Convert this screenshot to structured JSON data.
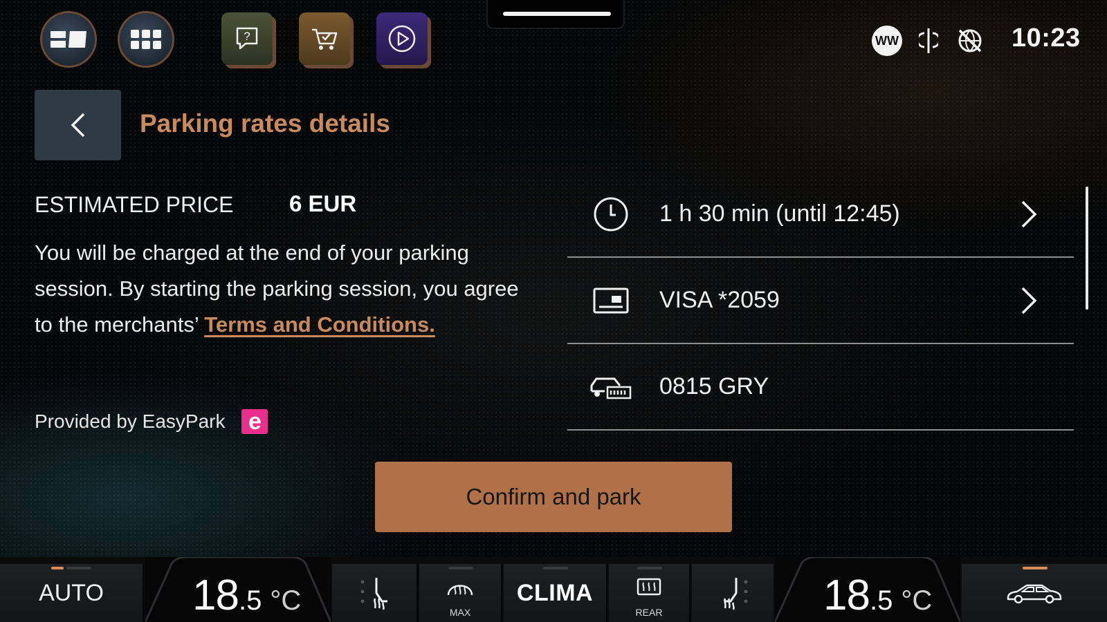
{
  "top_bar": {
    "clock": "10:23",
    "status_badge": "WW"
  },
  "header": {
    "title": "Parking rates details"
  },
  "estimate": {
    "label": "ESTIMATED PRICE",
    "value": "6 EUR"
  },
  "description": {
    "text": "You will be charged at the end of your parking session. By starting the parking session, you agree to the merchants’ ",
    "link": "Terms and Conditions."
  },
  "provider": {
    "label": "Provided by EasyPark",
    "logo_letter": "e"
  },
  "details": [
    {
      "icon": "clock-icon",
      "text": "1 h 30 min (until 12:45)",
      "has_chevron": true
    },
    {
      "icon": "card-icon",
      "text": "VISA *2059",
      "has_chevron": true
    },
    {
      "icon": "car-plate-icon",
      "text": "0815 GRY",
      "has_chevron": false
    }
  ],
  "confirm_button": "Confirm and park",
  "climate": {
    "auto": "AUTO",
    "left_temp_whole": "18",
    "left_temp_decimal": ".5",
    "right_temp_whole": "18",
    "right_temp_decimal": ".5",
    "unit": "°C",
    "defrost_label": "MAX",
    "clima": "CLIMA",
    "rear_label": "REAR"
  },
  "colors": {
    "accent": "#c98a5c",
    "button": "#b07148",
    "easypark": "#ea2f8b"
  }
}
